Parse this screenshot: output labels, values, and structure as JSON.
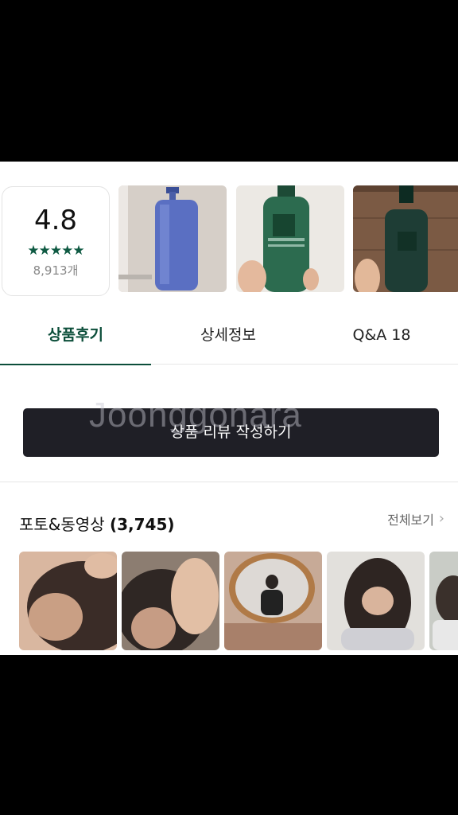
{
  "rating": {
    "value": "4.8",
    "stars": "★★★★★",
    "count": "8,913개"
  },
  "tabs": [
    {
      "label": "상품후기",
      "active": true
    },
    {
      "label": "상세정보",
      "active": false
    },
    {
      "label": "Q&A 18",
      "active": false
    }
  ],
  "write_review": {
    "label": "상품 리뷰 작성하기"
  },
  "watermark": "Joonggonara",
  "photo_section": {
    "title": "포토&동영상",
    "count": "(3,745)",
    "see_all": "전체보기"
  },
  "colors": {
    "accent": "#0c4e3a",
    "button": "#1f1f26"
  }
}
